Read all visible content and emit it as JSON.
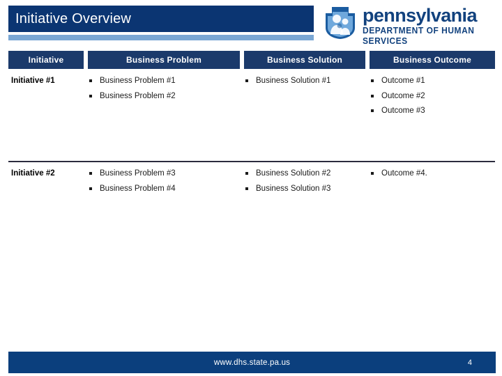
{
  "slide": {
    "title": "Initiative Overview"
  },
  "logo": {
    "keystone_icon": "pennsylvania-keystone-family-icon",
    "wordmark": "pennsylvania",
    "department": "DEPARTMENT OF HUMAN SERVICES",
    "brand_color": "#12427e",
    "keystone_fill": "#1b5ca0",
    "keystone_inner": "#6fa8dc"
  },
  "colors": {
    "title_band": "#0b3572",
    "title_underline": "#7aa7d4",
    "header_cell": "#1b3a6b",
    "footer": "#0b3f7d",
    "divider": "#2b2b3e"
  },
  "table": {
    "columns": [
      {
        "label": "Initiative"
      },
      {
        "label": "Business Problem"
      },
      {
        "label": "Business Solution"
      },
      {
        "label": "Business Outcome"
      }
    ],
    "rows": [
      {
        "initiative": "Initiative #1",
        "problems": [
          "Business Problem #1",
          "Business Problem #2"
        ],
        "solutions": [
          "Business Solution #1"
        ],
        "outcomes": [
          "Outcome #1",
          "Outcome #2",
          "Outcome #3"
        ]
      },
      {
        "initiative": "Initiative #2",
        "problems": [
          "Business Problem #3",
          "Business Problem #4"
        ],
        "solutions": [
          "Business Solution #2",
          "Business Solution #3"
        ],
        "outcomes": [
          "Outcome #4."
        ]
      }
    ]
  },
  "footer": {
    "url": "www.dhs.state.pa.us",
    "page_number": "4"
  }
}
